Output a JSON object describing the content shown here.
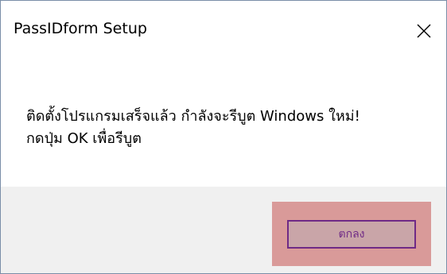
{
  "window": {
    "title": "PassIDform Setup",
    "close_icon": "close-icon"
  },
  "message": {
    "line1": "ติดตั้งโปรแกรมเสร็จแล้ว กำลังจะรีบูต Windows ใหม่!",
    "line2": "กดปุ่ม OK เพื่อรีบูต"
  },
  "footer": {
    "ok_label": "ตกลง"
  },
  "colors": {
    "footer_bg": "#f0f0f0",
    "highlight": "#d99a99",
    "button_border": "#6f2a86",
    "button_fill": "#c9a5a8"
  }
}
